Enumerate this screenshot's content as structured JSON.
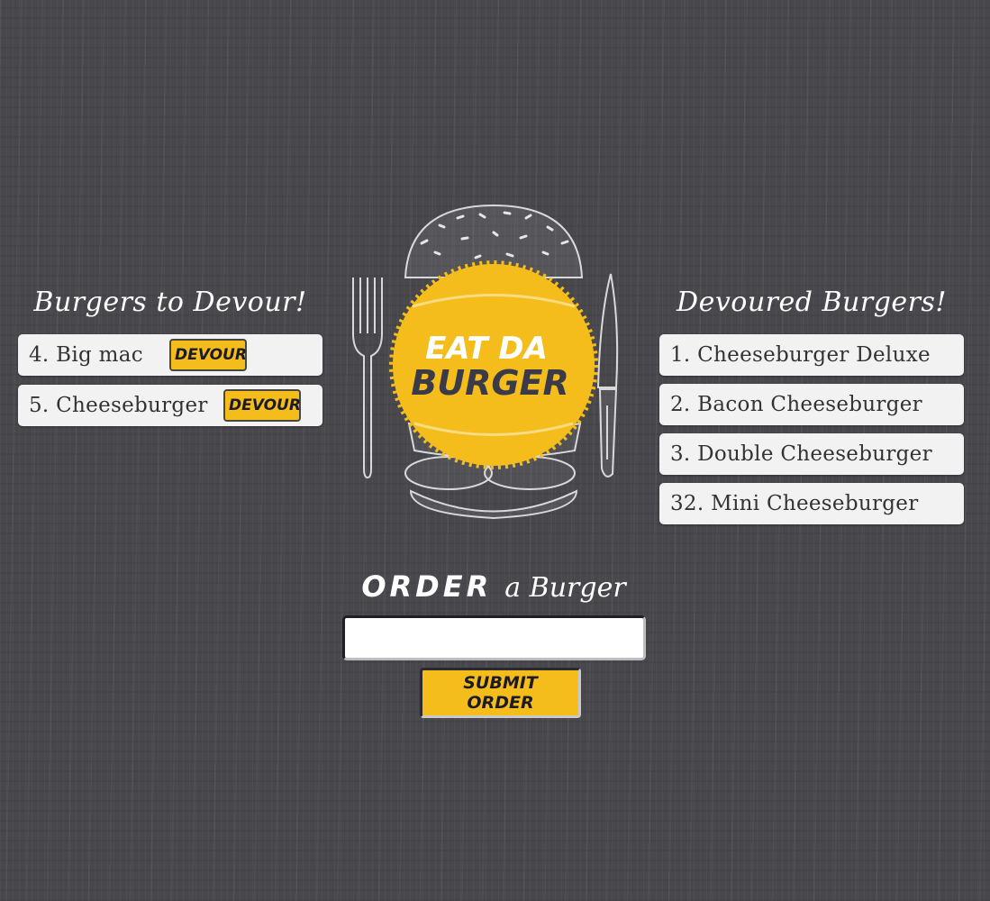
{
  "to_devour": {
    "heading": "Burgers to Devour!",
    "items": [
      {
        "label": "4. Big mac",
        "button": "DEVOUR"
      },
      {
        "label": "5. Cheeseburger",
        "button": "DEVOUR"
      }
    ]
  },
  "devoured": {
    "heading": "Devoured Burgers!",
    "items": [
      {
        "label": "1. Cheeseburger Deluxe"
      },
      {
        "label": "2. Bacon Cheeseburger"
      },
      {
        "label": "3. Double Cheeseburger"
      },
      {
        "label": "32. Mini Cheeseburger"
      }
    ]
  },
  "logo": {
    "line1": "EAT DA",
    "line2": "BURGER",
    "badge_color": "#f4bd1b",
    "text_color_top": "#ffffff",
    "text_color_bottom": "#3a3a4a"
  },
  "order": {
    "heading_emphasis": "ORDER",
    "heading_rest": "a Burger",
    "input_value": "",
    "input_placeholder": "",
    "submit_label": "SUBMIT ORDER"
  },
  "colors": {
    "background": "#48474c",
    "accent": "#f4bd1b",
    "card": "#f2f2f2"
  }
}
